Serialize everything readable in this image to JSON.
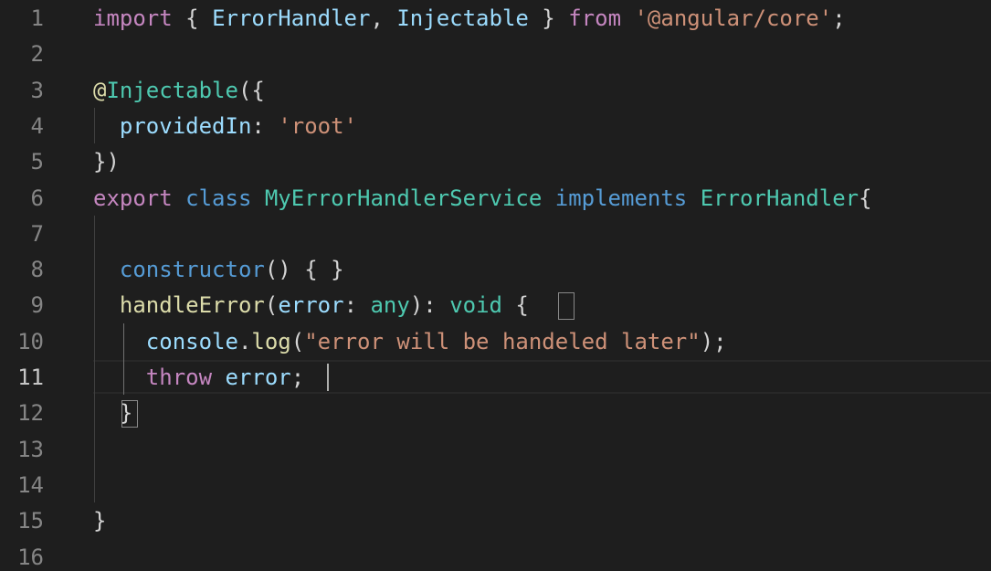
{
  "editor": {
    "theme": {
      "background": "#1e1e1e",
      "lineNumber": "#858585",
      "activeLineNumber": "#c6c6c6"
    },
    "active_line": "11",
    "lines": [
      {
        "number": "1",
        "tokens": [
          {
            "t": "import",
            "c": "kw"
          },
          {
            "t": " { ",
            "c": "punc"
          },
          {
            "t": "ErrorHandler",
            "c": "prop"
          },
          {
            "t": ", ",
            "c": "punc"
          },
          {
            "t": "Injectable",
            "c": "prop"
          },
          {
            "t": " } ",
            "c": "punc"
          },
          {
            "t": "from",
            "c": "kw"
          },
          {
            "t": " ",
            "c": "punc"
          },
          {
            "t": "'@angular/core'",
            "c": "st"
          },
          {
            "t": ";",
            "c": "punc"
          }
        ]
      },
      {
        "number": "2",
        "tokens": []
      },
      {
        "number": "3",
        "tokens": [
          {
            "t": "@",
            "c": "dec"
          },
          {
            "t": "Injectable",
            "c": "cls"
          },
          {
            "t": "({",
            "c": "punc"
          }
        ]
      },
      {
        "number": "4",
        "tokens": [
          {
            "t": "  ",
            "c": "punc"
          },
          {
            "t": "providedIn",
            "c": "prop"
          },
          {
            "t": ": ",
            "c": "punc"
          },
          {
            "t": "'root'",
            "c": "st"
          }
        ]
      },
      {
        "number": "5",
        "tokens": [
          {
            "t": "})",
            "c": "punc"
          }
        ]
      },
      {
        "number": "6",
        "tokens": [
          {
            "t": "export",
            "c": "kw"
          },
          {
            "t": " ",
            "c": "punc"
          },
          {
            "t": "class",
            "c": "sto"
          },
          {
            "t": " ",
            "c": "punc"
          },
          {
            "t": "MyErrorHandlerService",
            "c": "cls"
          },
          {
            "t": " ",
            "c": "punc"
          },
          {
            "t": "implements",
            "c": "sto"
          },
          {
            "t": " ",
            "c": "punc"
          },
          {
            "t": "ErrorHandler",
            "c": "cls"
          },
          {
            "t": "{",
            "c": "punc"
          }
        ]
      },
      {
        "number": "7",
        "tokens": []
      },
      {
        "number": "8",
        "tokens": [
          {
            "t": "  ",
            "c": "punc"
          },
          {
            "t": "constructor",
            "c": "sto"
          },
          {
            "t": "() { }",
            "c": "punc"
          }
        ]
      },
      {
        "number": "9",
        "tokens": [
          {
            "t": "  ",
            "c": "punc"
          },
          {
            "t": "handleError",
            "c": "fn"
          },
          {
            "t": "(",
            "c": "punc"
          },
          {
            "t": "error",
            "c": "prop"
          },
          {
            "t": ": ",
            "c": "punc"
          },
          {
            "t": "any",
            "c": "type"
          },
          {
            "t": "): ",
            "c": "punc"
          },
          {
            "t": "void",
            "c": "type"
          },
          {
            "t": " {",
            "c": "punc"
          }
        ]
      },
      {
        "number": "10",
        "tokens": [
          {
            "t": "    ",
            "c": "punc"
          },
          {
            "t": "console",
            "c": "prop"
          },
          {
            "t": ".",
            "c": "punc"
          },
          {
            "t": "log",
            "c": "fn"
          },
          {
            "t": "(",
            "c": "punc"
          },
          {
            "t": "\"error will be handeled later\"",
            "c": "st"
          },
          {
            "t": ");",
            "c": "punc"
          }
        ]
      },
      {
        "number": "11",
        "tokens": [
          {
            "t": "    ",
            "c": "punc"
          },
          {
            "t": "throw",
            "c": "kw"
          },
          {
            "t": " ",
            "c": "punc"
          },
          {
            "t": "error",
            "c": "prop"
          },
          {
            "t": ";",
            "c": "punc"
          }
        ]
      },
      {
        "number": "12",
        "tokens": [
          {
            "t": "  }",
            "c": "punc"
          }
        ]
      },
      {
        "number": "13",
        "tokens": []
      },
      {
        "number": "14",
        "tokens": []
      },
      {
        "number": "15",
        "tokens": [
          {
            "t": "}",
            "c": "punc"
          }
        ]
      },
      {
        "number": "16",
        "tokens": []
      }
    ]
  }
}
